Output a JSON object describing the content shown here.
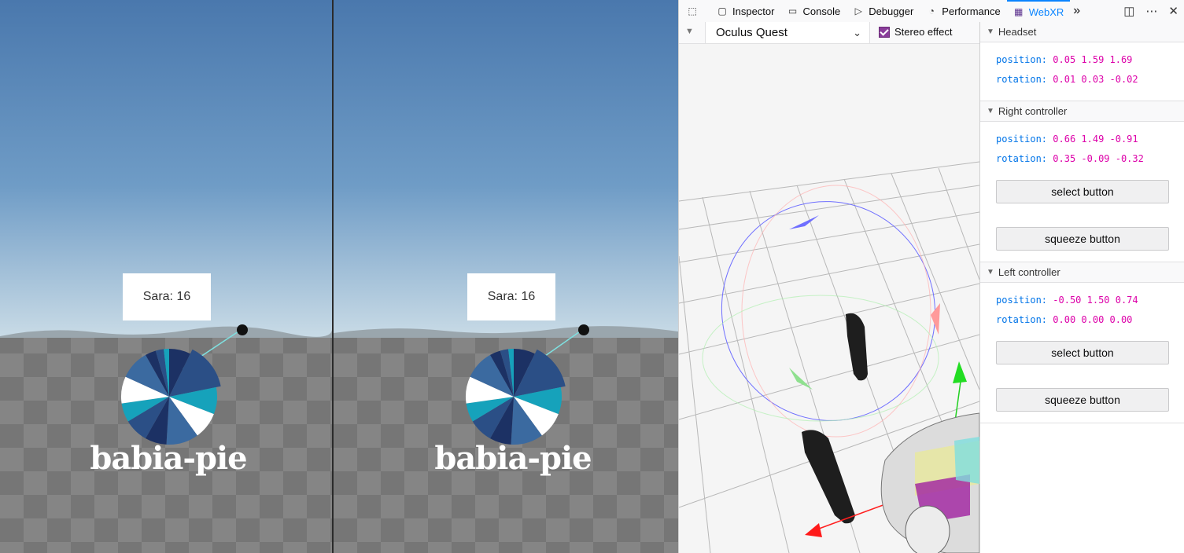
{
  "scene": {
    "tooltip_text": "Sara: 16",
    "title": "babia-pie",
    "sky_top_color": "#4a78ad",
    "sky_horizon_color": "#c9dbe6",
    "pie_colors": [
      "#1c3164",
      "#2b4f86",
      "#16a2bb",
      "#ffffff",
      "#3b6aa0"
    ]
  },
  "chart_data": {
    "type": "pie",
    "title": "babia-pie",
    "highlighted_label": "Sara: 16",
    "note": "values not printed; slice sizes estimated visually",
    "values": [
      8,
      16,
      10,
      10,
      12,
      8,
      9,
      7,
      10,
      11,
      4,
      3,
      2
    ]
  },
  "devtools": {
    "tabs": [
      {
        "label": "Inspector",
        "icon": "inspector-icon"
      },
      {
        "label": "Console",
        "icon": "console-icon"
      },
      {
        "label": "Debugger",
        "icon": "debugger-icon"
      },
      {
        "label": "Performance",
        "icon": "performance-icon"
      },
      {
        "label": "WebXR",
        "icon": "webxr-icon",
        "active": true
      }
    ],
    "device": "Oculus Quest",
    "device_chevron": "⌄",
    "stereo_label": "Stereo effect",
    "sections": {
      "headset": {
        "title": "Headset",
        "position_label": "position:",
        "position": "0.05 1.59 1.69",
        "rotation_label": "rotation:",
        "rotation": "0.01 0.03 -0.02"
      },
      "right": {
        "title": "Right controller",
        "position_label": "position:",
        "position": "0.66 1.49 -0.91",
        "rotation_label": "rotation:",
        "rotation": "0.35 -0.09 -0.32",
        "select": "select button",
        "squeeze": "squeeze button"
      },
      "left": {
        "title": "Left controller",
        "position_label": "position:",
        "position": "-0.50 1.50 0.74",
        "rotation_label": "rotation:",
        "rotation": "0.00 0.00 0.00",
        "select": "select button",
        "squeeze": "squeeze button"
      }
    }
  }
}
